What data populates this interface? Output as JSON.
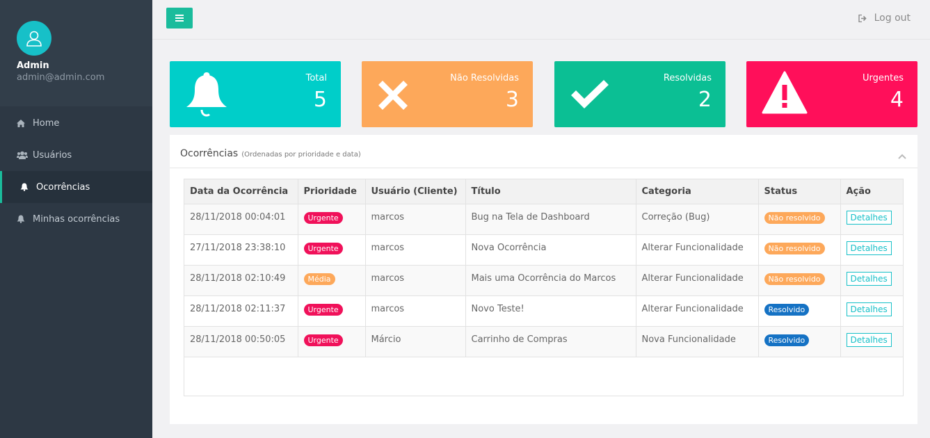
{
  "sidebar": {
    "user_name": "Admin",
    "user_email": "admin@admin.com",
    "items": [
      {
        "label": "Home",
        "icon": "home-icon"
      },
      {
        "label": "Usuários",
        "icon": "users-icon"
      },
      {
        "label": "Ocorrências",
        "icon": "bell-icon",
        "active": true
      },
      {
        "label": "Minhas ocorrências",
        "icon": "bell-icon"
      }
    ]
  },
  "topbar": {
    "logout_label": "Log out"
  },
  "stats": [
    {
      "label": "Total",
      "value": "5",
      "icon": "bell-icon",
      "color": "#00cec9"
    },
    {
      "label": "Não Resolvidas",
      "value": "3",
      "icon": "x-icon",
      "color": "#fda85a"
    },
    {
      "label": "Resolvidas",
      "value": "2",
      "icon": "check-icon",
      "color": "#0bbf94"
    },
    {
      "label": "Urgentes",
      "value": "4",
      "icon": "warning-icon",
      "color": "#ff0f5a"
    }
  ],
  "panel": {
    "title": "Ocorrências",
    "subtitle": "(Ordenadas por prioridade e data)"
  },
  "table": {
    "headers": [
      "Data da Ocorrência",
      "Prioridade",
      "Usuário (Cliente)",
      "Título",
      "Categoria",
      "Status",
      "Ação"
    ],
    "rows": [
      {
        "date": "28/11/2018 00:04:01",
        "priority": "Urgente",
        "user": "marcos",
        "title": "Bug na Tela de Dashboard",
        "category": "Correção (Bug)",
        "status": "Não resolvido",
        "action": "Detalhes"
      },
      {
        "date": "27/11/2018 23:38:10",
        "priority": "Urgente",
        "user": "marcos",
        "title": "Nova Ocorrência",
        "category": "Alterar Funcionalidade",
        "status": "Não resolvido",
        "action": "Detalhes"
      },
      {
        "date": "28/11/2018 02:10:49",
        "priority": "Média",
        "user": "marcos",
        "title": "Mais uma Ocorrência do Marcos",
        "category": "Alterar Funcionalidade",
        "status": "Não resolvido",
        "action": "Detalhes"
      },
      {
        "date": "28/11/2018 02:11:37",
        "priority": "Urgente",
        "user": "marcos",
        "title": "Novo Teste!",
        "category": "Alterar Funcionalidade",
        "status": "Resolvido",
        "action": "Detalhes"
      },
      {
        "date": "28/11/2018 00:50:05",
        "priority": "Urgente",
        "user": "Márcio",
        "title": "Carrinho de Compras",
        "category": "Nova Funcionalidade",
        "status": "Resolvido",
        "action": "Detalhes"
      }
    ]
  },
  "colors": {
    "urgente": "#f0115a",
    "media": "#fda85a",
    "nao_resolvido": "#fda85a",
    "resolvido": "#1572c4",
    "accent": "#1abc9c"
  }
}
